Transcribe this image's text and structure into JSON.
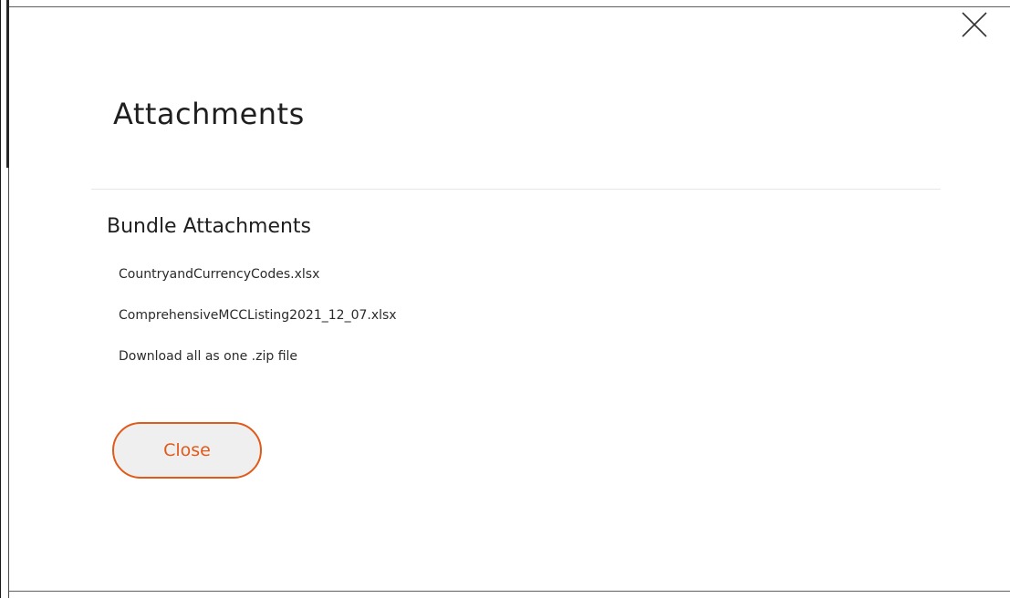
{
  "modal": {
    "title": "Attachments",
    "section_title": "Bundle Attachments",
    "attachments": [
      "CountryandCurrencyCodes.xlsx",
      "ComprehensiveMCCListing2021_12_07.xlsx",
      "Download all as one .zip file"
    ],
    "close_button_label": "Close",
    "close_icon": "close-x-icon"
  },
  "colors": {
    "accent": "#e05a1a",
    "button_bg": "#efefef",
    "text": "#1f1f1f",
    "divider": "#e6e6e6"
  }
}
